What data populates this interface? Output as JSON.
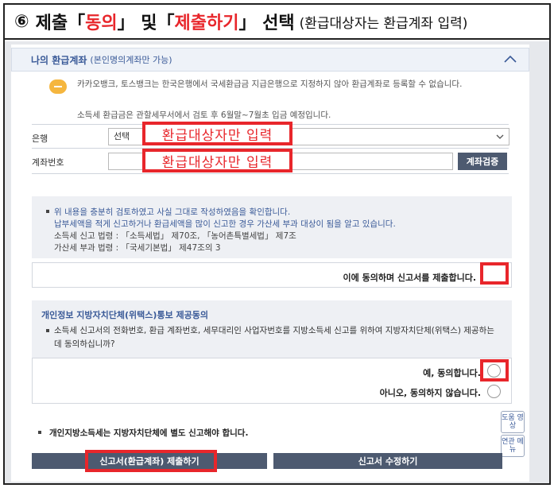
{
  "headline": {
    "num": "⑥",
    "t1": "제출「",
    "t2": "동의",
    "t3": "」 및「",
    "t4": "제출하기",
    "t5": "」 선택",
    "t6": "(환급대상자는 환급계좌 입력)"
  },
  "section": {
    "title": "나의 환급계좌",
    "subtitle": "(본인명의계좌만 가능)"
  },
  "info": {
    "line1": "카카오뱅크, 토스뱅크는 한국은행에서 국세환급금 지급은행으로 지정하지 않아 환급계좌로 등록할 수 없습니다.",
    "line2": "소득세 환급금은 관할세무서에서 검토 후 6월말~7월초 입금 예정입니다."
  },
  "form": {
    "bank_label": "은행",
    "bank_value": "선택",
    "account_label": "계좌번호",
    "verify_label": "계좌검증"
  },
  "callouts": {
    "refund_only": "환급대상자만 입력"
  },
  "notice": {
    "line1": "위 내용을 충분히 검토하였고 사실 그대로 작성하였음을 확인합니다.",
    "line2": "납부세액을 적게 신고하거나 환급세액을 많이 신고한 경우 가산세 부과 대상이 됨을 알고 있습니다.",
    "line3": "소득세 신고 법령 : 「소득세법」 제70조, 「농어촌특별세법」 제7조",
    "line4": "가산세 부과 법령 : 「국세기본법」 제47조의 3"
  },
  "agree": {
    "text": "이에 동의하며 신고서를 제출합니다."
  },
  "privacy": {
    "title": "개인정보 지방자치단체(위택스)통보 제공동의",
    "body": "소득세 신고서의 전화번호, 환급 계좌번호, 세무대리인 사업자번호를 지방소득세 신고를 위하여 지방자치단체(위택스) 제공하는데 동의하십니까?",
    "yes": "예, 동의합니다.",
    "no": "아니오, 동의하지 않습니다."
  },
  "bottom": {
    "note": "개인지방소득세는 지방자치단체에 별도 신고해야 합니다.",
    "help": "도움 영상",
    "menu": "연관 메뉴",
    "submit": "신고서(환급계좌) 제출하기",
    "edit": "신고서 수정하기"
  },
  "colors": {
    "highlight": "#e8262b",
    "button": "#4d5a70",
    "link": "#3a5a98"
  }
}
